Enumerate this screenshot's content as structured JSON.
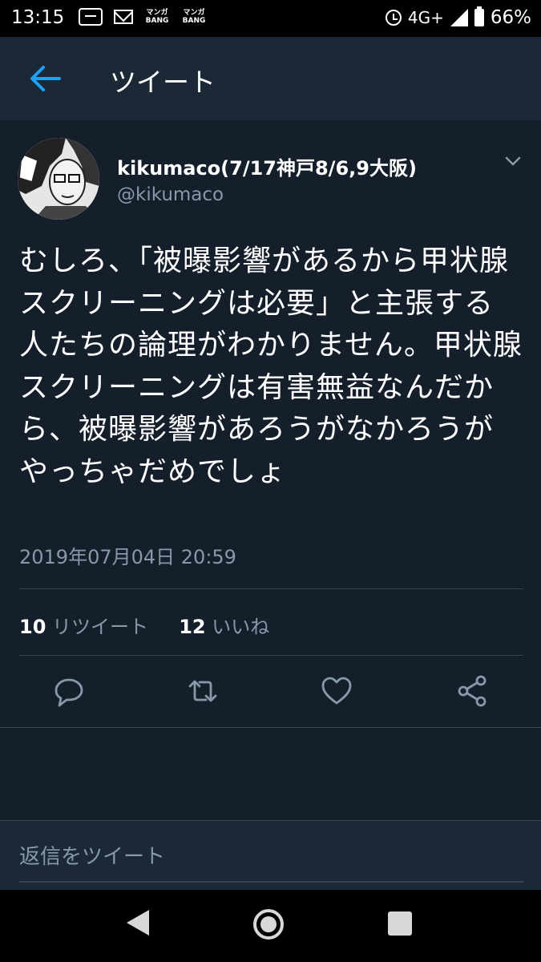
{
  "status_bar": {
    "time": "13:15",
    "manga_badge_1": "マンガ\nBANG",
    "manga_badge_2": "マンガ\nBANG",
    "network": "4G+",
    "battery": "66%"
  },
  "header": {
    "title": "ツイート",
    "back_icon": "arrow-left-icon"
  },
  "tweet": {
    "display_name": "kikumaco(7/17神戸8/6,9大阪)",
    "handle": "@kikumaco",
    "text": "むしろ、「被曝影響があるから甲状腺スクリーニングは必要」と主張する人たちの論理がわかりません。甲状腺スクリーニングは有害無益なんだから、被曝影響があろうがなかろうがやっちゃだめでしょ",
    "timestamp": "2019年07月04日 20:59",
    "retweet_count": "10",
    "retweet_label": "リツイート",
    "like_count": "12",
    "like_label": "いいね"
  },
  "actions": [
    "reply-icon",
    "retweet-icon",
    "like-icon",
    "share-icon"
  ],
  "reply_bar": {
    "placeholder": "返信をツイート"
  },
  "colors": {
    "background": "#151f2c",
    "header": "#1b2836",
    "accent": "#1da1f2",
    "secondary_text": "#8899a6",
    "divider": "#38444d"
  }
}
